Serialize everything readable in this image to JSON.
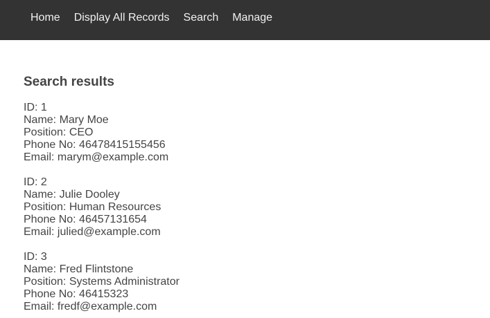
{
  "nav": {
    "items": [
      "Home",
      "Display All Records",
      "Search",
      "Manage"
    ]
  },
  "main": {
    "heading": "Search results",
    "records": [
      {
        "id": "ID: 1",
        "name": "Name: Mary Moe",
        "position": "Position: CEO",
        "phone": "Phone No: 46478415155456",
        "email": "Email: marym@example.com"
      },
      {
        "id": "ID: 2",
        "name": "Name: Julie Dooley",
        "position": "Position: Human Resources",
        "phone": "Phone No: 46457131654",
        "email": "Email: julied@example.com"
      },
      {
        "id": "ID: 3",
        "name": "Name: Fred Flintstone",
        "position": "Position: Systems Administrator",
        "phone": "Phone No: 46415323",
        "email": "Email: fredf@example.com"
      }
    ]
  }
}
